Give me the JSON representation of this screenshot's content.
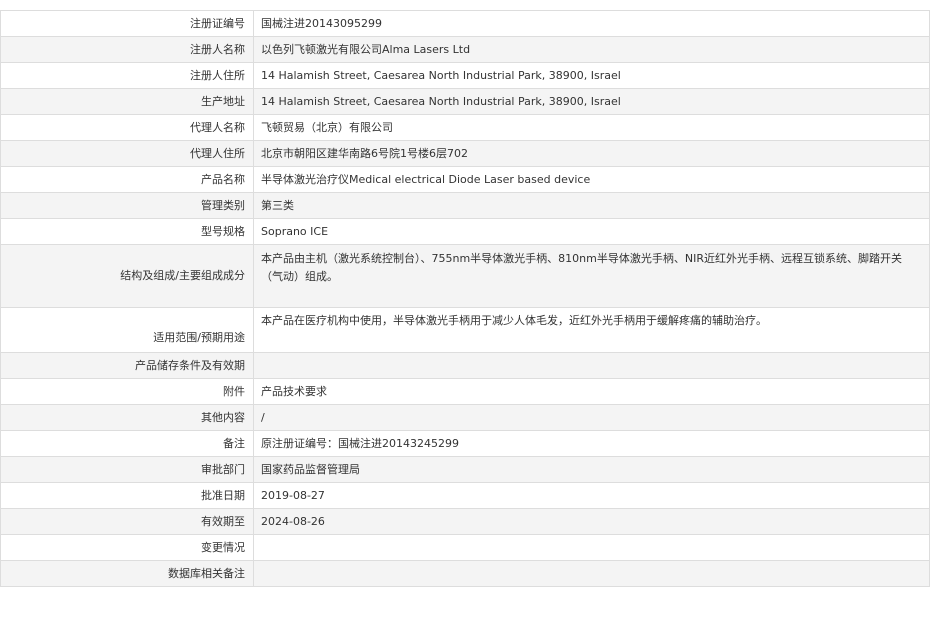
{
  "rows": [
    {
      "label": "注册证编号",
      "value": "国械注进20143095299"
    },
    {
      "label": "注册人名称",
      "value": "以色列飞顿激光有限公司Alma Lasers Ltd"
    },
    {
      "label": "注册人住所",
      "value": "14 Halamish Street, Caesarea North Industrial Park, 38900, Israel"
    },
    {
      "label": "生产地址",
      "value": "14 Halamish Street, Caesarea North Industrial Park, 38900, Israel"
    },
    {
      "label": "代理人名称",
      "value": "飞顿贸易（北京）有限公司"
    },
    {
      "label": "代理人住所",
      "value": "北京市朝阳区建华南路6号院1号楼6层702"
    },
    {
      "label": "产品名称",
      "value": "半导体激光治疗仪Medical electrical Diode Laser based device"
    },
    {
      "label": "管理类别",
      "value": "第三类"
    },
    {
      "label": "型号规格",
      "value": "Soprano ICE"
    },
    {
      "label": "结构及组成/主要组成成分",
      "value": "本产品由主机（激光系统控制台）、755nm半导体激光手柄、810nm半导体激光手柄、NIR近红外光手柄、远程互锁系统、脚踏开关（气动）组成。"
    },
    {
      "label": "适用范围/预期用途",
      "value": "本产品在医疗机构中使用，半导体激光手柄用于减少人体毛发，近红外光手柄用于缓解疼痛的辅助治疗。"
    },
    {
      "label": "产品储存条件及有效期",
      "value": ""
    },
    {
      "label": "附件",
      "value": "产品技术要求"
    },
    {
      "label": "其他内容",
      "value": "/"
    },
    {
      "label": "备注",
      "value": "原注册证编号：国械注进20143245299"
    },
    {
      "label": "审批部门",
      "value": "国家药品监督管理局"
    },
    {
      "label": "批准日期",
      "value": "2019-08-27"
    },
    {
      "label": "有效期至",
      "value": "2024-08-26"
    },
    {
      "label": "变更情况",
      "value": ""
    },
    {
      "label": "数据库相关备注",
      "value": ""
    }
  ]
}
